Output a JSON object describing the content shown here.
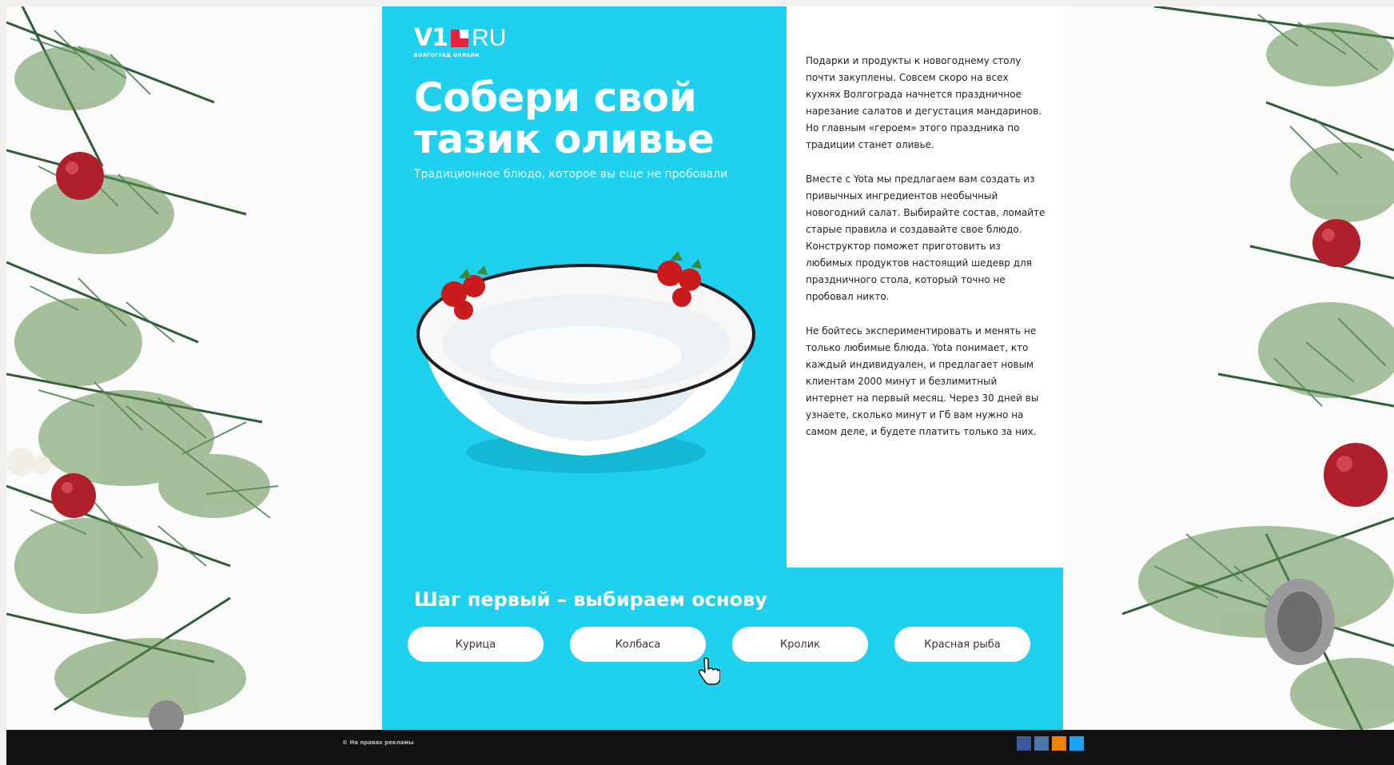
{
  "brand": {
    "logo_main": "V1",
    "logo_tld": "RU",
    "logo_sub": "ВОЛГОГРАД ОНЛАЙН"
  },
  "hero": {
    "title": "Собери свой тазик оливье",
    "subtitle": "Традиционное блюдо, которое вы еще не пробовали"
  },
  "article": {
    "paragraphs": [
      "Подарки и продукты к новогоднему столу почти закуплены. Совсем скоро на всех кухнях Волгограда начнется праздничное нарезание салатов и дегустация мандаринов. Но главным «героем» этого праздника по традиции станет оливье.",
      "Вместе с Yota мы предлагаем вам создать из привычных ингредиентов необычный новогодний салат. Выбирайте состав, ломайте старые правила и создавайте свое блюдо. Конструктор поможет приготовить из любимых продуктов настоящий шедевр для праздничного стола, который точно не пробовал никто.",
      "Не бойтесь экспериментировать и менять не только любимые блюда. Yota понимает, кто каждый индивидуален, и предлагает новым клиентам 2000 минут и безлимитный интернет на первый месяц. Через 30 дней вы узнаете, сколько минут и Гб вам нужно на самом деле, и будете платить только за них."
    ]
  },
  "step": {
    "title": "Шаг первый – выбираем основу",
    "options": [
      "Курица",
      "Колбаса",
      "Кролик",
      "Красная рыба"
    ]
  },
  "footer": {
    "copyright": "© На правах рекламы"
  },
  "colors": {
    "accent": "#1fd1ee",
    "footer": "#121212",
    "logo_red": "#e6233c"
  }
}
